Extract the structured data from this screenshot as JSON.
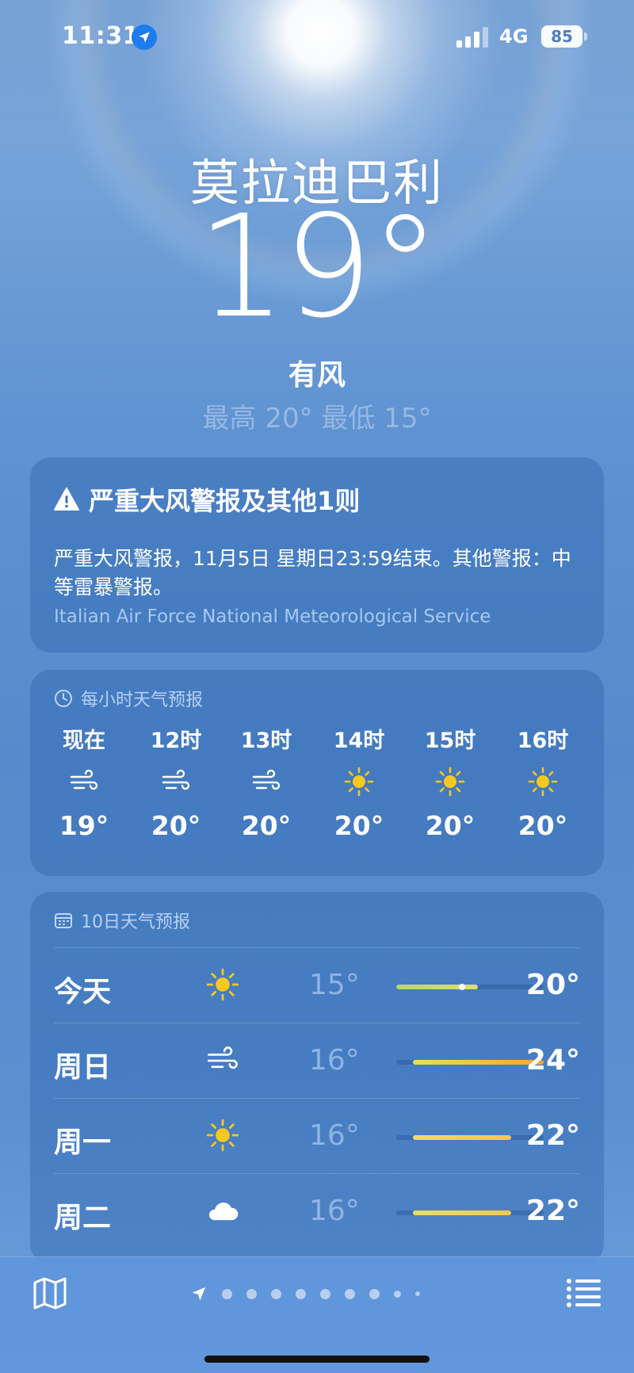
{
  "status_bar": {
    "time": "11:31",
    "network": "4G",
    "battery": "85"
  },
  "header": {
    "city": "莫拉迪巴利",
    "temperature": "19°",
    "condition": "有风",
    "hi_lo": "最高 20°  最低 15°"
  },
  "alert": {
    "title": "严重大风警报及其他1则",
    "body": "严重大风警报，11月5日 星期日23:59结束。其他警报：中等雷暴警报。",
    "source": "Italian Air Force National Meteorological Service"
  },
  "hourly": {
    "title": "每小时天气预报",
    "items": [
      {
        "time": "现在",
        "icon": "wind-icon",
        "temp": "19°"
      },
      {
        "time": "12时",
        "icon": "wind-icon",
        "temp": "20°"
      },
      {
        "time": "13时",
        "icon": "wind-icon",
        "temp": "20°"
      },
      {
        "time": "14时",
        "icon": "sun-icon",
        "temp": "20°"
      },
      {
        "time": "15时",
        "icon": "sun-icon",
        "temp": "20°"
      },
      {
        "time": "16时",
        "icon": "sun-icon",
        "temp": "20°"
      }
    ]
  },
  "daily": {
    "title": "10日天气预报",
    "range": [
      15,
      24
    ],
    "days": [
      {
        "day": "今天",
        "icon": "sun-icon",
        "low": "15°",
        "high": "20°",
        "low_val": 15,
        "high_val": 20,
        "current_val": 19,
        "colors": [
          "#b9d86a",
          "#dbe06a"
        ]
      },
      {
        "day": "周日",
        "icon": "wind-icon",
        "low": "16°",
        "high": "24°",
        "low_val": 16,
        "high_val": 24,
        "colors": [
          "#f0dc5a",
          "#f3a82a"
        ]
      },
      {
        "day": "周一",
        "icon": "sun-icon",
        "low": "16°",
        "high": "22°",
        "low_val": 16,
        "high_val": 22,
        "colors": [
          "#eadf66",
          "#f1c94a"
        ]
      },
      {
        "day": "周二",
        "icon": "cloud-icon",
        "low": "16°",
        "high": "22°",
        "low_val": 16,
        "high_val": 22,
        "colors": [
          "#eadf66",
          "#f1c94a"
        ]
      }
    ]
  },
  "colors": {
    "sun": "#f7c81e",
    "location_badge": "#1e7bf0"
  }
}
